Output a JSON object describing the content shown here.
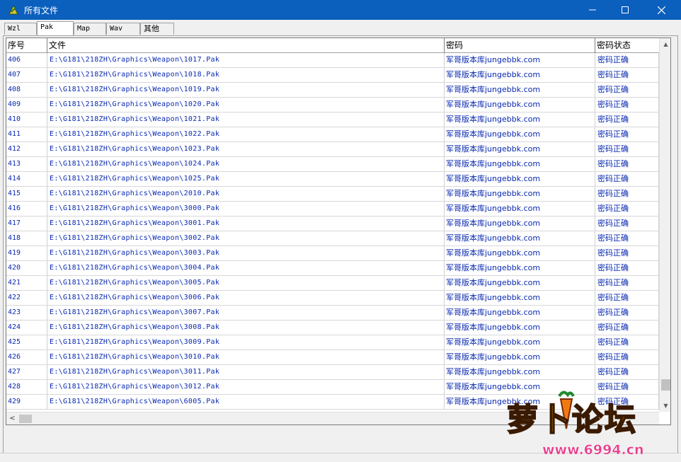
{
  "window": {
    "title": "所有文件",
    "title_bar_color": "#0b5fbd"
  },
  "tabs": [
    {
      "label": "Wzl",
      "active": false
    },
    {
      "label": "Pak",
      "active": true
    },
    {
      "label": "Map",
      "active": false
    },
    {
      "label": "Wav",
      "active": false
    },
    {
      "label": "其他",
      "active": false
    }
  ],
  "table": {
    "columns": [
      "序号",
      "文件",
      "密码",
      "密码状态"
    ],
    "text_color": "#0a2ab0",
    "rows": [
      [
        "406",
        "E:\\G181\\218ZH\\Graphics\\Weapon\\1017.Pak",
        "军哥版本库jungebbk.com",
        "密码正确"
      ],
      [
        "407",
        "E:\\G181\\218ZH\\Graphics\\Weapon\\1018.Pak",
        "军哥版本库jungebbk.com",
        "密码正确"
      ],
      [
        "408",
        "E:\\G181\\218ZH\\Graphics\\Weapon\\1019.Pak",
        "军哥版本库jungebbk.com",
        "密码正确"
      ],
      [
        "409",
        "E:\\G181\\218ZH\\Graphics\\Weapon\\1020.Pak",
        "军哥版本库jungebbk.com",
        "密码正确"
      ],
      [
        "410",
        "E:\\G181\\218ZH\\Graphics\\Weapon\\1021.Pak",
        "军哥版本库jungebbk.com",
        "密码正确"
      ],
      [
        "411",
        "E:\\G181\\218ZH\\Graphics\\Weapon\\1022.Pak",
        "军哥版本库jungebbk.com",
        "密码正确"
      ],
      [
        "412",
        "E:\\G181\\218ZH\\Graphics\\Weapon\\1023.Pak",
        "军哥版本库jungebbk.com",
        "密码正确"
      ],
      [
        "413",
        "E:\\G181\\218ZH\\Graphics\\Weapon\\1024.Pak",
        "军哥版本库jungebbk.com",
        "密码正确"
      ],
      [
        "414",
        "E:\\G181\\218ZH\\Graphics\\Weapon\\1025.Pak",
        "军哥版本库jungebbk.com",
        "密码正确"
      ],
      [
        "415",
        "E:\\G181\\218ZH\\Graphics\\Weapon\\2010.Pak",
        "军哥版本库jungebbk.com",
        "密码正确"
      ],
      [
        "416",
        "E:\\G181\\218ZH\\Graphics\\Weapon\\3000.Pak",
        "军哥版本库jungebbk.com",
        "密码正确"
      ],
      [
        "417",
        "E:\\G181\\218ZH\\Graphics\\Weapon\\3001.Pak",
        "军哥版本库jungebbk.com",
        "密码正确"
      ],
      [
        "418",
        "E:\\G181\\218ZH\\Graphics\\Weapon\\3002.Pak",
        "军哥版本库jungebbk.com",
        "密码正确"
      ],
      [
        "419",
        "E:\\G181\\218ZH\\Graphics\\Weapon\\3003.Pak",
        "军哥版本库jungebbk.com",
        "密码正确"
      ],
      [
        "420",
        "E:\\G181\\218ZH\\Graphics\\Weapon\\3004.Pak",
        "军哥版本库jungebbk.com",
        "密码正确"
      ],
      [
        "421",
        "E:\\G181\\218ZH\\Graphics\\Weapon\\3005.Pak",
        "军哥版本库jungebbk.com",
        "密码正确"
      ],
      [
        "422",
        "E:\\G181\\218ZH\\Graphics\\Weapon\\3006.Pak",
        "军哥版本库jungebbk.com",
        "密码正确"
      ],
      [
        "423",
        "E:\\G181\\218ZH\\Graphics\\Weapon\\3007.Pak",
        "军哥版本库jungebbk.com",
        "密码正确"
      ],
      [
        "424",
        "E:\\G181\\218ZH\\Graphics\\Weapon\\3008.Pak",
        "军哥版本库jungebbk.com",
        "密码正确"
      ],
      [
        "425",
        "E:\\G181\\218ZH\\Graphics\\Weapon\\3009.Pak",
        "军哥版本库jungebbk.com",
        "密码正确"
      ],
      [
        "426",
        "E:\\G181\\218ZH\\Graphics\\Weapon\\3010.Pak",
        "军哥版本库jungebbk.com",
        "密码正确"
      ],
      [
        "427",
        "E:\\G181\\218ZH\\Graphics\\Weapon\\3011.Pak",
        "军哥版本库jungebbk.com",
        "密码正确"
      ],
      [
        "428",
        "E:\\G181\\218ZH\\Graphics\\Weapon\\3012.Pak",
        "军哥版本库jungebbk.com",
        "密码正确"
      ],
      [
        "429",
        "E:\\G181\\218ZH\\Graphics\\Weapon\\6005.Pak",
        "军哥版本库jungebbk.com",
        "密码正确"
      ]
    ]
  },
  "watermark": {
    "logo_text": "萝卜论坛",
    "url": "www.6994.cn"
  }
}
